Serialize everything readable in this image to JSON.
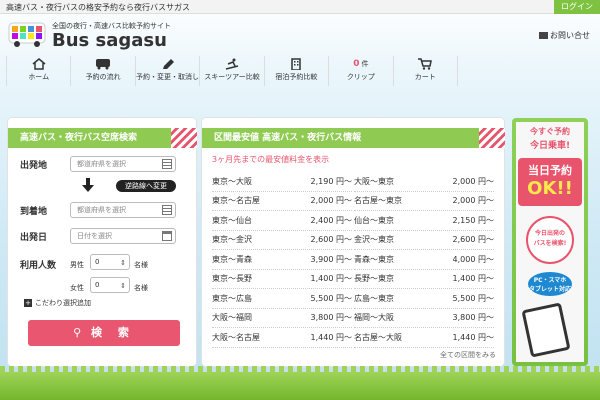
{
  "topbar": {
    "tagline": "高速バス・夜行バスの格安予約なら夜行バスサガス",
    "login": "ログイン"
  },
  "logo": {
    "subtitle": "全国の夜行・高速バス比較予約サイト",
    "name": "Bus sagasu"
  },
  "contact": {
    "label": "お問い合せ"
  },
  "nav": [
    {
      "label": "ホーム",
      "icon": "home-icon"
    },
    {
      "label": "予約の流れ",
      "icon": "bus-icon"
    },
    {
      "label": "予約・変更・取消し",
      "icon": "pen-icon"
    },
    {
      "label": "スキーツアー比較",
      "icon": "ski-icon"
    },
    {
      "label": "宿泊予約比較",
      "icon": "building-icon"
    },
    {
      "label": "クリップ",
      "icon": "clip-icon",
      "badge": "0",
      "badge_suffix": "件"
    },
    {
      "label": "カート",
      "icon": "cart-icon"
    }
  ],
  "search": {
    "title": "高速バス・夜行バス空席検索",
    "departure_label": "出発地",
    "departure_placeholder": "都道府県を選択",
    "reverse_label": "逆路線へ変更",
    "arrival_label": "到着地",
    "arrival_placeholder": "都道府県を選択",
    "date_label": "出発日",
    "date_placeholder": "日付を選択",
    "people_label": "利用人数",
    "male_label": "男性",
    "male_value": "0",
    "female_label": "女性",
    "female_value": "0",
    "unit": "名様",
    "advanced": "こだわり選択追加",
    "submit": "検 索"
  },
  "prices": {
    "title": "区間最安値 高速バス・夜行バス情報",
    "subtitle": "3ヶ月先までの最安値料金を表示",
    "left": [
      {
        "route": "東京〜大阪",
        "price": "2,190 円〜"
      },
      {
        "route": "東京〜名古屋",
        "price": "2,000 円〜"
      },
      {
        "route": "東京〜仙台",
        "price": "2,400 円〜"
      },
      {
        "route": "東京〜金沢",
        "price": "2,600 円〜"
      },
      {
        "route": "東京〜青森",
        "price": "3,900 円〜"
      },
      {
        "route": "東京〜長野",
        "price": "1,400 円〜"
      },
      {
        "route": "東京〜広島",
        "price": "5,500 円〜"
      },
      {
        "route": "大阪〜福岡",
        "price": "3,800 円〜"
      },
      {
        "route": "大阪〜名古屋",
        "price": "1,440 円〜"
      }
    ],
    "right": [
      {
        "route": "大阪〜東京",
        "price": "2,000 円〜"
      },
      {
        "route": "名古屋〜東京",
        "price": "2,000 円〜"
      },
      {
        "route": "仙台〜東京",
        "price": "2,150 円〜"
      },
      {
        "route": "金沢〜東京",
        "price": "2,600 円〜"
      },
      {
        "route": "青森〜東京",
        "price": "4,000 円〜"
      },
      {
        "route": "長野〜東京",
        "price": "1,400 円〜"
      },
      {
        "route": "広島〜東京",
        "price": "5,500 円〜"
      },
      {
        "route": "福岡〜大阪",
        "price": "3,800 円〜"
      },
      {
        "route": "名古屋〜大阪",
        "price": "1,440 円〜"
      }
    ],
    "more": "全ての区間をみる"
  },
  "banner": {
    "line1": "今すぐ予約",
    "line2": "今日乗車!",
    "big1": "当日予約",
    "big2": "OK!!",
    "circle1": "今日出発の",
    "circle2": "バスを検索!",
    "pc1": "PC・スマホ",
    "pc2": "タブレット対応"
  },
  "colors": {
    "accent_green": "#8fca53",
    "accent_pink": "#e8546c",
    "login_green": "#7fc241"
  }
}
